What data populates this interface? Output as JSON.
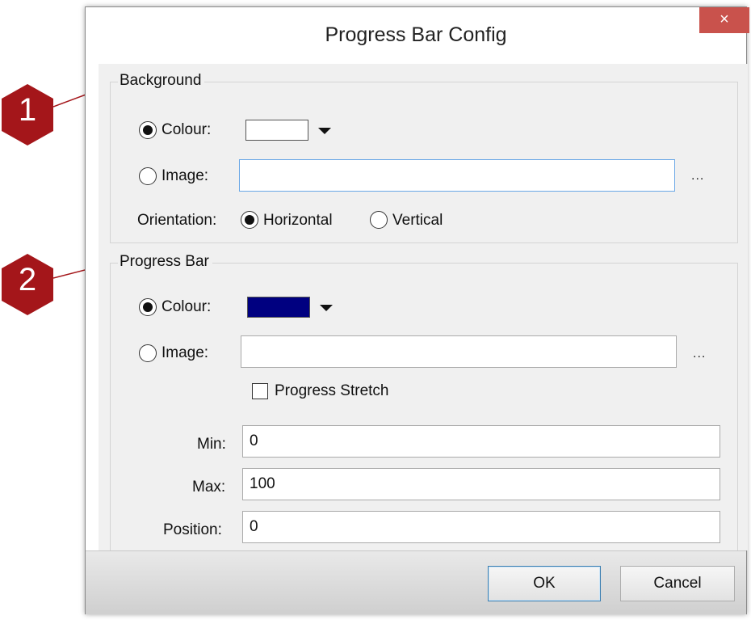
{
  "window": {
    "title": "Progress Bar Config",
    "close_glyph": "×"
  },
  "callouts": [
    {
      "label": "1",
      "color": "#a4161a"
    },
    {
      "label": "2",
      "color": "#a4161a"
    }
  ],
  "background_group": {
    "legend": "Background",
    "colour_label": "Colour:",
    "colour_selected": true,
    "colour_value": "#ffffff",
    "image_label": "Image:",
    "image_selected": false,
    "image_value": "",
    "browse_label": "...",
    "orientation_label": "Orientation:",
    "orientation_options": [
      "Horizontal",
      "Vertical"
    ],
    "orientation_selected": "Horizontal"
  },
  "progress_group": {
    "legend": "Progress Bar",
    "colour_label": "Colour:",
    "colour_selected": true,
    "colour_value": "#000080",
    "image_label": "Image:",
    "image_selected": false,
    "image_value": "",
    "browse_label": "...",
    "stretch_label": "Progress Stretch",
    "stretch_checked": false,
    "min_label": "Min:",
    "min_value": "0",
    "max_label": "Max:",
    "max_value": "100",
    "position_label": "Position:",
    "position_value": "0"
  },
  "buttons": {
    "ok": "OK",
    "cancel": "Cancel"
  },
  "icons": {
    "dropdown": "chevron-down-icon",
    "close": "close-icon"
  }
}
